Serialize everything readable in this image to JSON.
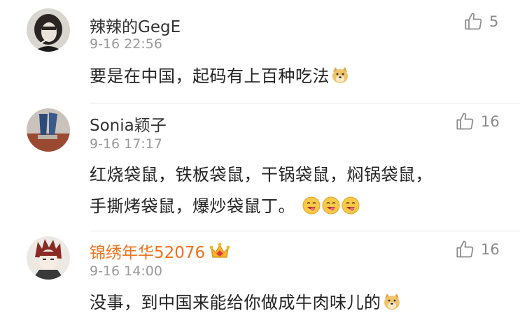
{
  "comments": [
    {
      "username": "辣辣的GegE",
      "time": "9-16 22:56",
      "likes": "5",
      "avatar_icon": "woman-smoking-avatar",
      "lines": [
        "要是在中国，起码有上百种吃法"
      ],
      "emojis": [
        "doge-emoji"
      ]
    },
    {
      "username": "Sonia颖子",
      "time": "9-16 17:17",
      "likes": "16",
      "avatar_icon": "legs-in-jeans-avatar",
      "lines": [
        "红烧袋鼠，铁板袋鼠，干锅袋鼠，焖锅袋鼠，",
        "手撕烤袋鼠，爆炒袋鼠丁。"
      ],
      "emojis": [
        "drool-emoji",
        "drool-emoji",
        "drool-emoji"
      ]
    },
    {
      "username": "锦绣年华52076",
      "time": "9-16 14:00",
      "likes": "16",
      "avatar_icon": "anime-boy-avatar",
      "badge_icon": "crown-icon",
      "lines": [
        "没事，到中国来能给你做成牛肉味儿的"
      ],
      "emojis": [
        "doge-emoji"
      ]
    }
  ],
  "colors": {
    "vip_name": "#f0731d",
    "meta": "#9a9a9a",
    "divider": "#e6e6e6"
  }
}
